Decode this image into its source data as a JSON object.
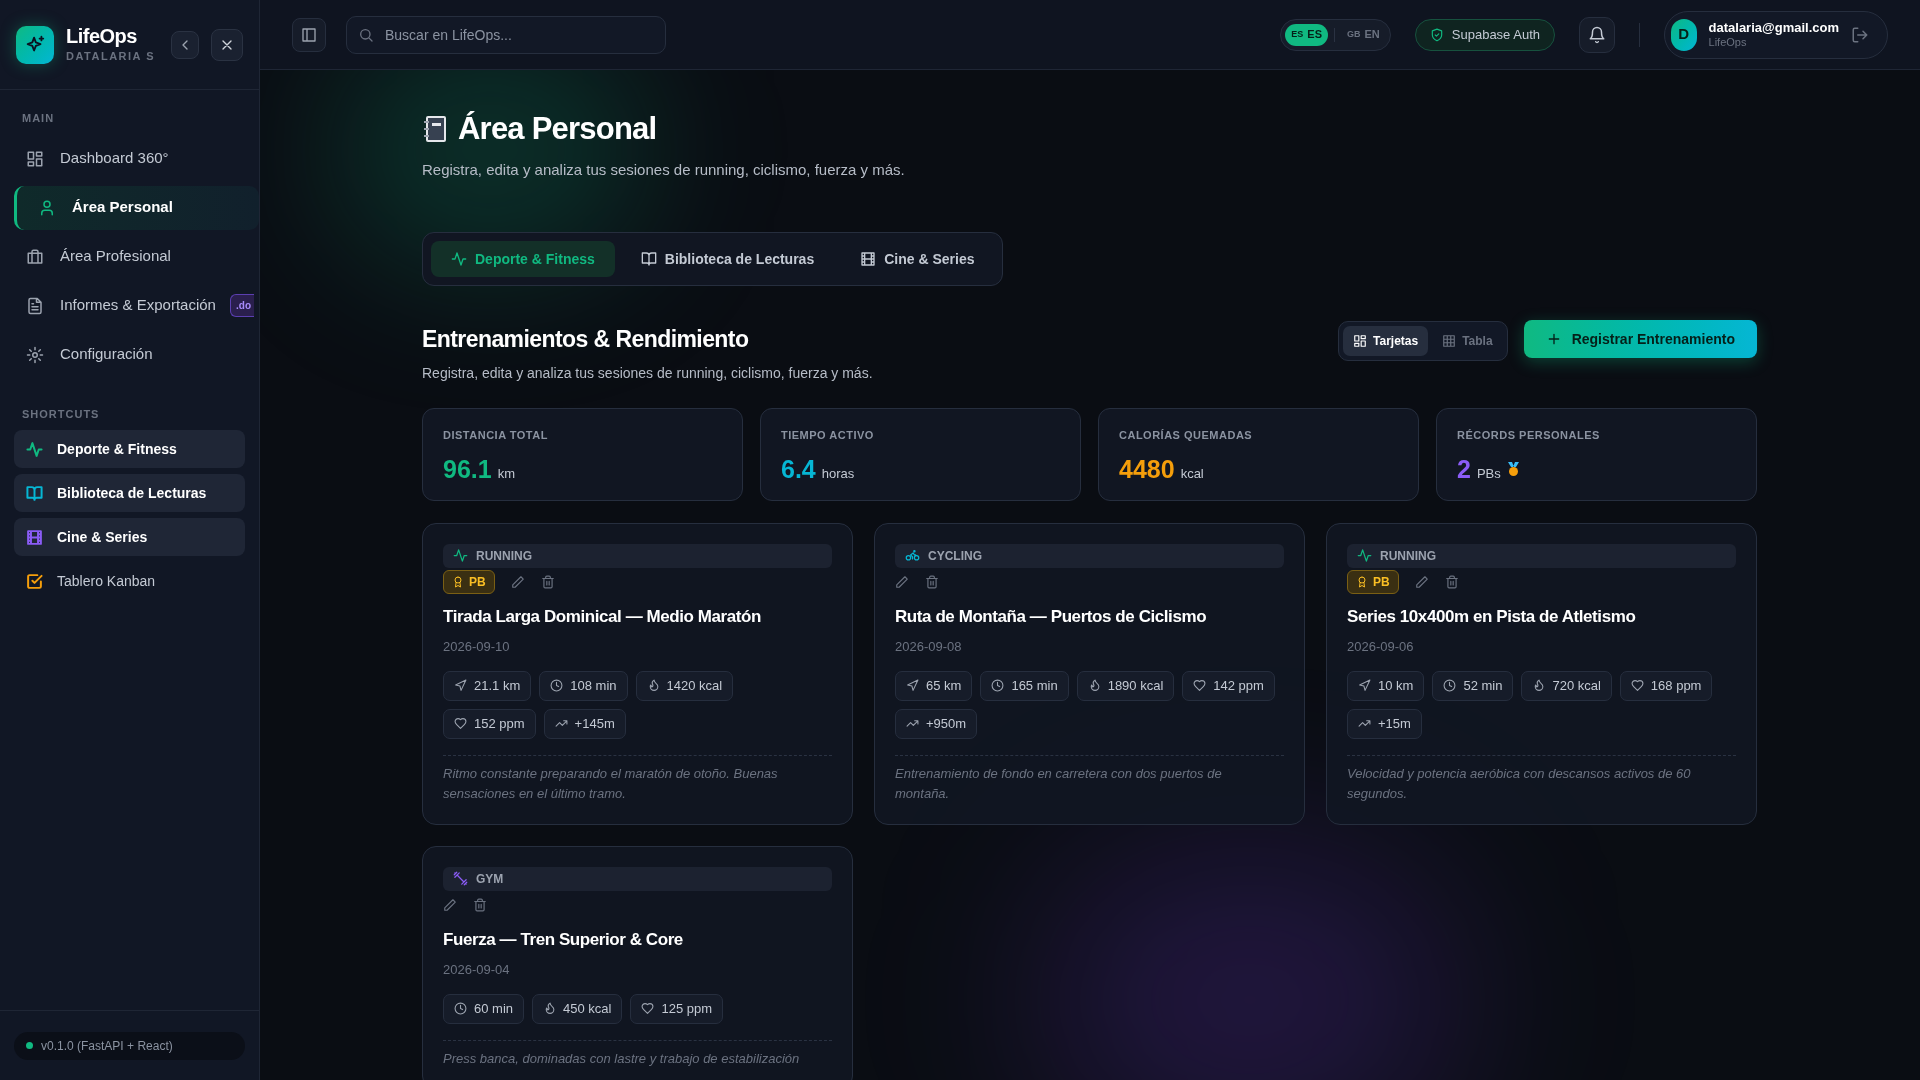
{
  "sidebar": {
    "app_name": "LifeOps",
    "workspace": "DATALARIA S",
    "main_label": "MAIN",
    "items": [
      {
        "label": "Dashboard 360°",
        "selected": false
      },
      {
        "label": "Área Personal",
        "selected": true
      },
      {
        "label": "Área Profesional",
        "selected": false
      },
      {
        "label": "Informes & Exportación",
        "selected": false,
        "badge": ".do"
      },
      {
        "label": "Configuración",
        "selected": false
      }
    ],
    "shortcuts_label": "SHORTCUTS",
    "shortcuts": [
      {
        "label": "Deporte & Fitness",
        "highlighted": true,
        "color": "#10b981"
      },
      {
        "label": "Biblioteca de Lecturas",
        "highlighted": true,
        "color": "#06b6d4"
      },
      {
        "label": "Cine & Series",
        "highlighted": true,
        "color": "#8b5cf6"
      },
      {
        "label": "Tablero Kanban",
        "highlighted": false,
        "color": "#f59e0b"
      }
    ],
    "version": "v0.1.0 (FastAPI + React)"
  },
  "header": {
    "search": {
      "placeholder": "Buscar en LifeOps..."
    },
    "languages": [
      {
        "flag": "ES",
        "label": "ES",
        "selected": true
      },
      {
        "flag": "GB",
        "label": "EN",
        "selected": false
      }
    ],
    "auth_badge": "Supabase Auth",
    "user": {
      "initial": "D",
      "email": "datalaria@gmail.com",
      "app": "LifeOps"
    }
  },
  "page": {
    "title": "Área Personal",
    "subtitle": "Registra, edita y analiza tus sesiones de running, ciclismo, fuerza y más.",
    "tabs": [
      {
        "label": "Deporte & Fitness",
        "selected": true
      },
      {
        "label": "Biblioteca de Lecturas",
        "selected": false
      },
      {
        "label": "Cine & Series",
        "selected": false
      }
    ]
  },
  "section": {
    "title": "Entrenamientos & Rendimiento",
    "subtitle": "Registra, edita y analiza tus sesiones de running, ciclismo, fuerza y más.",
    "views": [
      {
        "label": "Tarjetas",
        "selected": true
      },
      {
        "label": "Tabla",
        "selected": false
      }
    ],
    "primary_button": "Registrar Entrenamiento",
    "stats": [
      {
        "label": "DISTANCIA TOTAL",
        "value": "96.1",
        "unit": "km",
        "color": "#10b981"
      },
      {
        "label": "TIEMPO ACTIVO",
        "value": "6.4",
        "unit": "horas",
        "color": "#06b6d4"
      },
      {
        "label": "CALORÍAS QUEMADAS",
        "value": "4480",
        "unit": "kcal",
        "color": "#f59e0b"
      },
      {
        "label": "RÉCORDS PERSONALES",
        "value": "2",
        "unit": "PBs",
        "color": "#8b5cf6",
        "medal": true
      }
    ],
    "workouts": [
      {
        "kind": "running",
        "type_label": "RUNNING",
        "pb": true,
        "pb_label": "PB",
        "title": "Tirada Larga Dominical — Medio Maratón",
        "date": "2026-09-10",
        "metrics": [
          {
            "kind": "distance",
            "text": "21.1 km"
          },
          {
            "kind": "time",
            "text": "108 min"
          },
          {
            "kind": "calories",
            "text": "1420 kcal"
          },
          {
            "kind": "heart",
            "text": "152 ppm"
          },
          {
            "kind": "elevation",
            "text": "+145m"
          }
        ],
        "notes": "Ritmo constante preparando el maratón de otoño. Buenas sensaciones en el último tramo."
      },
      {
        "kind": "cycling",
        "type_label": "CYCLING",
        "pb": false,
        "title": "Ruta de Montaña — Puertos de Ciclismo",
        "date": "2026-09-08",
        "metrics": [
          {
            "kind": "distance",
            "text": "65 km"
          },
          {
            "kind": "time",
            "text": "165 min"
          },
          {
            "kind": "calories",
            "text": "1890 kcal"
          },
          {
            "kind": "heart",
            "text": "142 ppm"
          },
          {
            "kind": "elevation",
            "text": "+950m"
          }
        ],
        "notes": "Entrenamiento de fondo en carretera con dos puertos de montaña."
      },
      {
        "kind": "running",
        "type_label": "RUNNING",
        "pb": true,
        "pb_label": "PB",
        "title": "Series 10x400m en Pista de Atletismo",
        "date": "2026-09-06",
        "metrics": [
          {
            "kind": "distance",
            "text": "10 km"
          },
          {
            "kind": "time",
            "text": "52 min"
          },
          {
            "kind": "calories",
            "text": "720 kcal"
          },
          {
            "kind": "heart",
            "text": "168 ppm"
          },
          {
            "kind": "elevation",
            "text": "+15m"
          }
        ],
        "notes": "Velocidad y potencia aeróbica con descansos activos de 60 segundos."
      },
      {
        "kind": "gym",
        "type_label": "GYM",
        "pb": false,
        "title": "Fuerza — Tren Superior & Core",
        "date": "2026-09-04",
        "metrics": [
          {
            "kind": "time",
            "text": "60 min"
          },
          {
            "kind": "calories",
            "text": "450 kcal"
          },
          {
            "kind": "heart",
            "text": "125 ppm"
          }
        ],
        "notes": "Press banca, dominadas con lastre y trabajo de estabilización"
      }
    ]
  }
}
